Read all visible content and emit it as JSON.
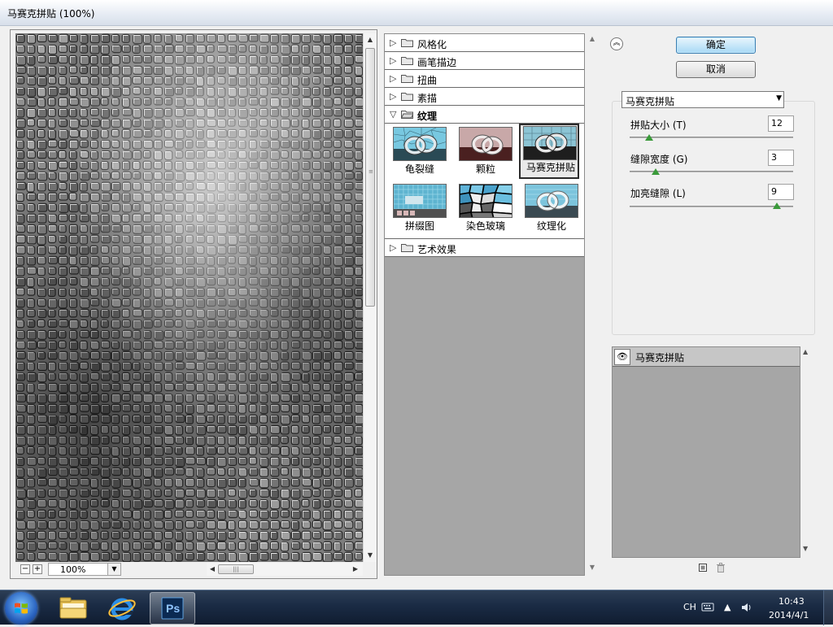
{
  "window": {
    "title": "马赛克拼贴 (100%)"
  },
  "preview": {
    "zoom_minus": "−",
    "zoom_plus": "+",
    "zoom_value": "100%"
  },
  "gallery": {
    "categories_top": [
      {
        "label": "风格化",
        "open": false
      },
      {
        "label": "画笔描边",
        "open": false
      },
      {
        "label": "扭曲",
        "open": false
      },
      {
        "label": "素描",
        "open": false
      },
      {
        "label": "纹理",
        "open": true
      }
    ],
    "texture_filters": [
      {
        "label": "龟裂缝",
        "selected": false,
        "icon": "craquelure-thumbnail"
      },
      {
        "label": "颗粒",
        "selected": false,
        "icon": "grain-thumbnail"
      },
      {
        "label": "马赛克拼贴",
        "selected": true,
        "icon": "mosaic-tiles-thumbnail"
      },
      {
        "label": "拼缀图",
        "selected": false,
        "icon": "patchwork-thumbnail"
      },
      {
        "label": "染色玻璃",
        "selected": false,
        "icon": "stained-glass-thumbnail"
      },
      {
        "label": "纹理化",
        "selected": false,
        "icon": "texturizer-thumbnail"
      }
    ],
    "categories_bottom": [
      {
        "label": "艺术效果",
        "open": false
      }
    ]
  },
  "buttons": {
    "ok": "确定",
    "cancel": "取消"
  },
  "filter": {
    "selected": "马赛克拼贴",
    "params": [
      {
        "label": "拼贴大小 (T)",
        "value": "12",
        "fraction": 0.12
      },
      {
        "label": "缝隙宽度 (G)",
        "value": "3",
        "fraction": 0.16
      },
      {
        "label": "加亮缝隙 (L)",
        "value": "9",
        "fraction": 0.9
      }
    ]
  },
  "layers": {
    "items": [
      {
        "label": "马赛克拼贴",
        "visible": true
      }
    ]
  },
  "taskbar": {
    "apps": [
      {
        "name": "explorer",
        "icon": "folder-icon"
      },
      {
        "name": "internet-explorer",
        "icon": "ie-icon"
      },
      {
        "name": "photoshop",
        "icon": "ps-icon",
        "label": "Ps",
        "active": true
      }
    ],
    "lang": "CH",
    "time": "10:43",
    "date": "2014/4/1"
  },
  "colors": {
    "selection_border": "#2b2b2b",
    "slider_thumb": "#3a9a3a",
    "taskbar": "#1a2b44"
  }
}
